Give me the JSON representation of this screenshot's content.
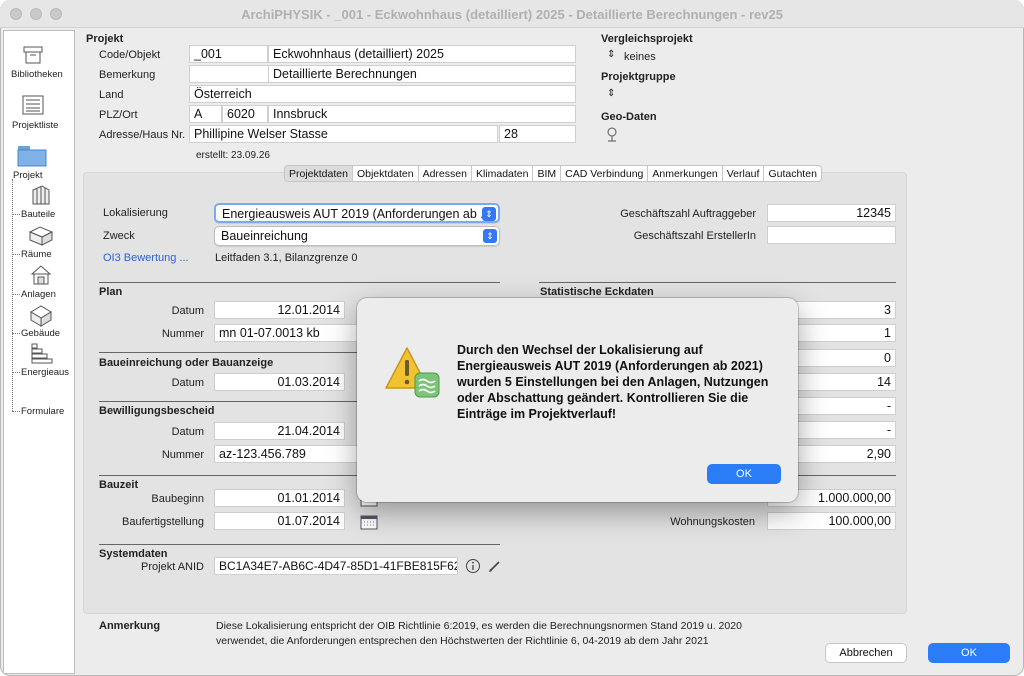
{
  "window": {
    "title": "ArchiPHYSIK - _001 - Eckwohnhaus (detailliert) 2025 - Detaillierte Berechnungen - rev25"
  },
  "sidebar": {
    "items": [
      {
        "label": "Bibliotheken",
        "icon": "archive-box-icon"
      },
      {
        "label": "Projektliste",
        "icon": "list-icon"
      },
      {
        "label": "Projekt",
        "icon": "folder-icon"
      },
      {
        "label": "Bauteile",
        "icon": "wall-layers-icon"
      },
      {
        "label": "Räume",
        "icon": "room-box-icon"
      },
      {
        "label": "Anlagen",
        "icon": "house-system-icon"
      },
      {
        "label": "Gebäude",
        "icon": "building-cube-icon"
      },
      {
        "label": "Energieaus",
        "icon": "energy-stairs-icon"
      },
      {
        "label": "Formulare",
        "icon": "none"
      }
    ]
  },
  "project": {
    "heading": "Projekt",
    "code_label": "Code/Objekt",
    "code": "_001",
    "object": "Eckwohnhaus (detailliert) 2025",
    "remark_label": "Bemerkung",
    "remark": "Detaillierte Berechnungen",
    "country_label": "Land",
    "country": "Österreich",
    "zip_label": "PLZ/Ort",
    "country_code": "A",
    "zip": "6020",
    "city": "Innsbruck",
    "address_label": "Adresse/Haus Nr.",
    "street": "Phillipine Welser Stasse",
    "house_no": "28",
    "created": "erstellt: 23.09.26"
  },
  "right": {
    "compare_heading": "Vergleichsprojekt",
    "compare_value": "keines",
    "group_heading": "Projektgruppe",
    "geo_heading": "Geo-Daten"
  },
  "tabs": [
    "Projektdaten",
    "Objektdaten",
    "Adressen",
    "Klimadaten",
    "BIM",
    "CAD Verbindung",
    "Anmerkungen",
    "Verlauf",
    "Gutachten"
  ],
  "form": {
    "loc_label": "Lokalisierung",
    "loc_value": "Energieausweis AUT 2019 (Anforderungen ab ...",
    "purpose_label": "Zweck",
    "purpose_value": "Baueinreichung",
    "oi3_link": "OI3 Bewertung ...",
    "oi3_value": "Leitfaden 3.1, Bilanzgrenze 0",
    "client_no_label": "Geschäftszahl Auftraggeber",
    "client_no": "12345",
    "creator_no_label": "Geschäftszahl ErstellerIn",
    "creator_no": "",
    "plan": {
      "heading": "Plan",
      "date_label": "Datum",
      "date": "12.01.2014",
      "no_label": "Nummer",
      "no": "mn 01-07.0013 kb"
    },
    "submission": {
      "heading": "Baueinreichung oder Bauanzeige",
      "date_label": "Datum",
      "date": "01.03.2014"
    },
    "permit": {
      "heading": "Bewilligungsbescheid",
      "date_label": "Datum",
      "date": "21.04.2014",
      "no_label": "Nummer",
      "no": "az-123.456.789"
    },
    "construction": {
      "heading": "Bauzeit",
      "start_label": "Baubeginn",
      "start": "01.01.2014",
      "end_label": "Baufertigstellung",
      "end": "01.07.2014"
    },
    "system": {
      "heading": "Systemdaten",
      "anid_label": "Projekt ANID",
      "anid": "BC1A34E7-AB6C-4D47-85D1-41FBE815F62"
    },
    "stats": {
      "heading": "Statistische Eckdaten",
      "values": [
        "3",
        "1",
        "0",
        "14",
        "-",
        "-",
        "2,90",
        "1.000.000,00"
      ],
      "apartment_cost_label": "Wohnungskosten",
      "apartment_cost": "100.000,00"
    },
    "note_label": "Anmerkung",
    "note_text": "Diese Lokalisierung entspricht der OIB Richtlinie 6:2019, es werden die Berechnungsnormen Stand 2019 u. 2020 verwendet, die Anforderungen entsprechen den Höchstwerten der Richtlinie 6, 04-2019 ab dem Jahr 2021"
  },
  "buttons": {
    "cancel": "Abbrechen",
    "ok": "OK"
  },
  "dialog": {
    "message": "Durch den Wechsel der Lokalisierung auf Energieausweis AUT 2019 (Anforderungen ab 2021) wurden 5 Einstellungen bei den Anlagen, Nutzungen oder Abschattung geändert. Kontrollieren Sie die Einträge im Projektverlauf!",
    "ok": "OK"
  },
  "colors": {
    "accent": "#2a7cf7",
    "link": "#2d63d4",
    "warning": "#f2c230"
  }
}
